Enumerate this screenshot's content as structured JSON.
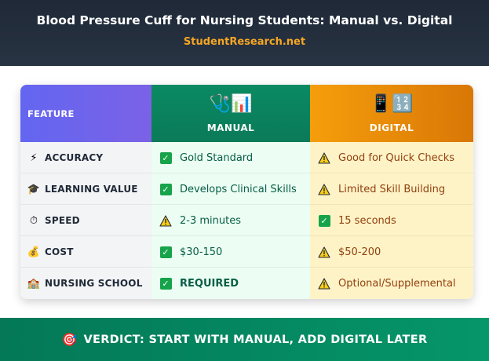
{
  "header": {
    "title": "Blood Pressure Cuff for Nursing Students: Manual vs. Digital",
    "site": "StudentResearch.net"
  },
  "table": {
    "columns": {
      "feature": "FEATURE",
      "manual": {
        "label": "MANUAL",
        "icons": "🩺📊"
      },
      "digital": {
        "label": "DIGITAL",
        "icons": "📱🔢"
      }
    },
    "rows": [
      {
        "icon": "⚡",
        "icon_name": "lightning-icon",
        "feature": "ACCURACY",
        "manual": {
          "status": "check",
          "text": "Gold Standard"
        },
        "digital": {
          "status": "warning",
          "text": "Good for Quick Checks"
        }
      },
      {
        "icon": "🎓",
        "icon_name": "graduation-cap-icon",
        "feature": "LEARNING VALUE",
        "manual": {
          "status": "check",
          "text": "Develops Clinical Skills"
        },
        "digital": {
          "status": "warning",
          "text": "Limited Skill Building"
        }
      },
      {
        "icon": "⏱",
        "icon_name": "stopwatch-icon",
        "feature": "SPEED",
        "manual": {
          "status": "warning",
          "text": "2-3 minutes"
        },
        "digital": {
          "status": "check",
          "text": "15 seconds"
        }
      },
      {
        "icon": "💰",
        "icon_name": "money-bag-icon",
        "feature": "COST",
        "manual": {
          "status": "check",
          "text": "$30-150"
        },
        "digital": {
          "status": "warning",
          "text": "$50-200"
        }
      },
      {
        "icon": "🏫",
        "icon_name": "school-icon",
        "feature": "NURSING SCHOOL",
        "manual": {
          "status": "check",
          "text": "REQUIRED",
          "strong": true
        },
        "digital": {
          "status": "warning",
          "text": "Optional/Supplemental"
        }
      }
    ]
  },
  "footer": {
    "icon": "🎯",
    "text": "VERDICT: START WITH MANUAL, ADD DIGITAL LATER"
  },
  "colors": {
    "header_bg": "#1f2937",
    "site_accent": "#f5a623",
    "feature_header": "#6366f1",
    "manual_header": "#0a8a62",
    "digital_header": "#f59e0b",
    "check_green": "#16a34a",
    "warning_yellow": "#facc15",
    "footer_bg": "#059669"
  }
}
